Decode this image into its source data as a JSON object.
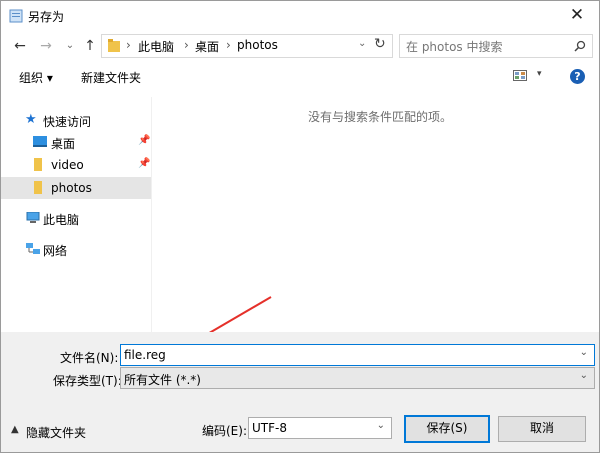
{
  "window": {
    "title": "另存为",
    "close_glyph": "✕"
  },
  "nav": {
    "back_glyph": "←",
    "forward_glyph": "→",
    "recent_glyph": "⌄",
    "up_glyph": "↑"
  },
  "address": {
    "crumbs": [
      "此电脑",
      "桌面",
      "photos"
    ],
    "separator": "›",
    "refresh_glyph": "↻"
  },
  "search": {
    "placeholder": "在 photos 中搜索"
  },
  "toolbar": {
    "organize": "组织 ▾",
    "new_folder": "新建文件夹",
    "help": "?"
  },
  "sidebar": {
    "quick_access": "快速访问",
    "items": [
      {
        "label": "桌面",
        "pinned": true
      },
      {
        "label": "video",
        "pinned": true
      },
      {
        "label": "photos",
        "pinned": false
      }
    ],
    "this_pc": "此电脑",
    "network": "网络"
  },
  "main": {
    "empty_message": "没有与搜索条件匹配的项。"
  },
  "form": {
    "filename_label": "文件名(N):",
    "filename_value": "file.reg",
    "filetype_label": "保存类型(T):",
    "filetype_value": "所有文件 (*.*)",
    "encoding_label": "编码(E):",
    "encoding_value": "UTF-8",
    "hide_folders": "隐藏文件夹",
    "save": "保存(S)",
    "cancel": "取消"
  },
  "colors": {
    "accent": "#0078d7",
    "arrow": "#e5302a"
  }
}
